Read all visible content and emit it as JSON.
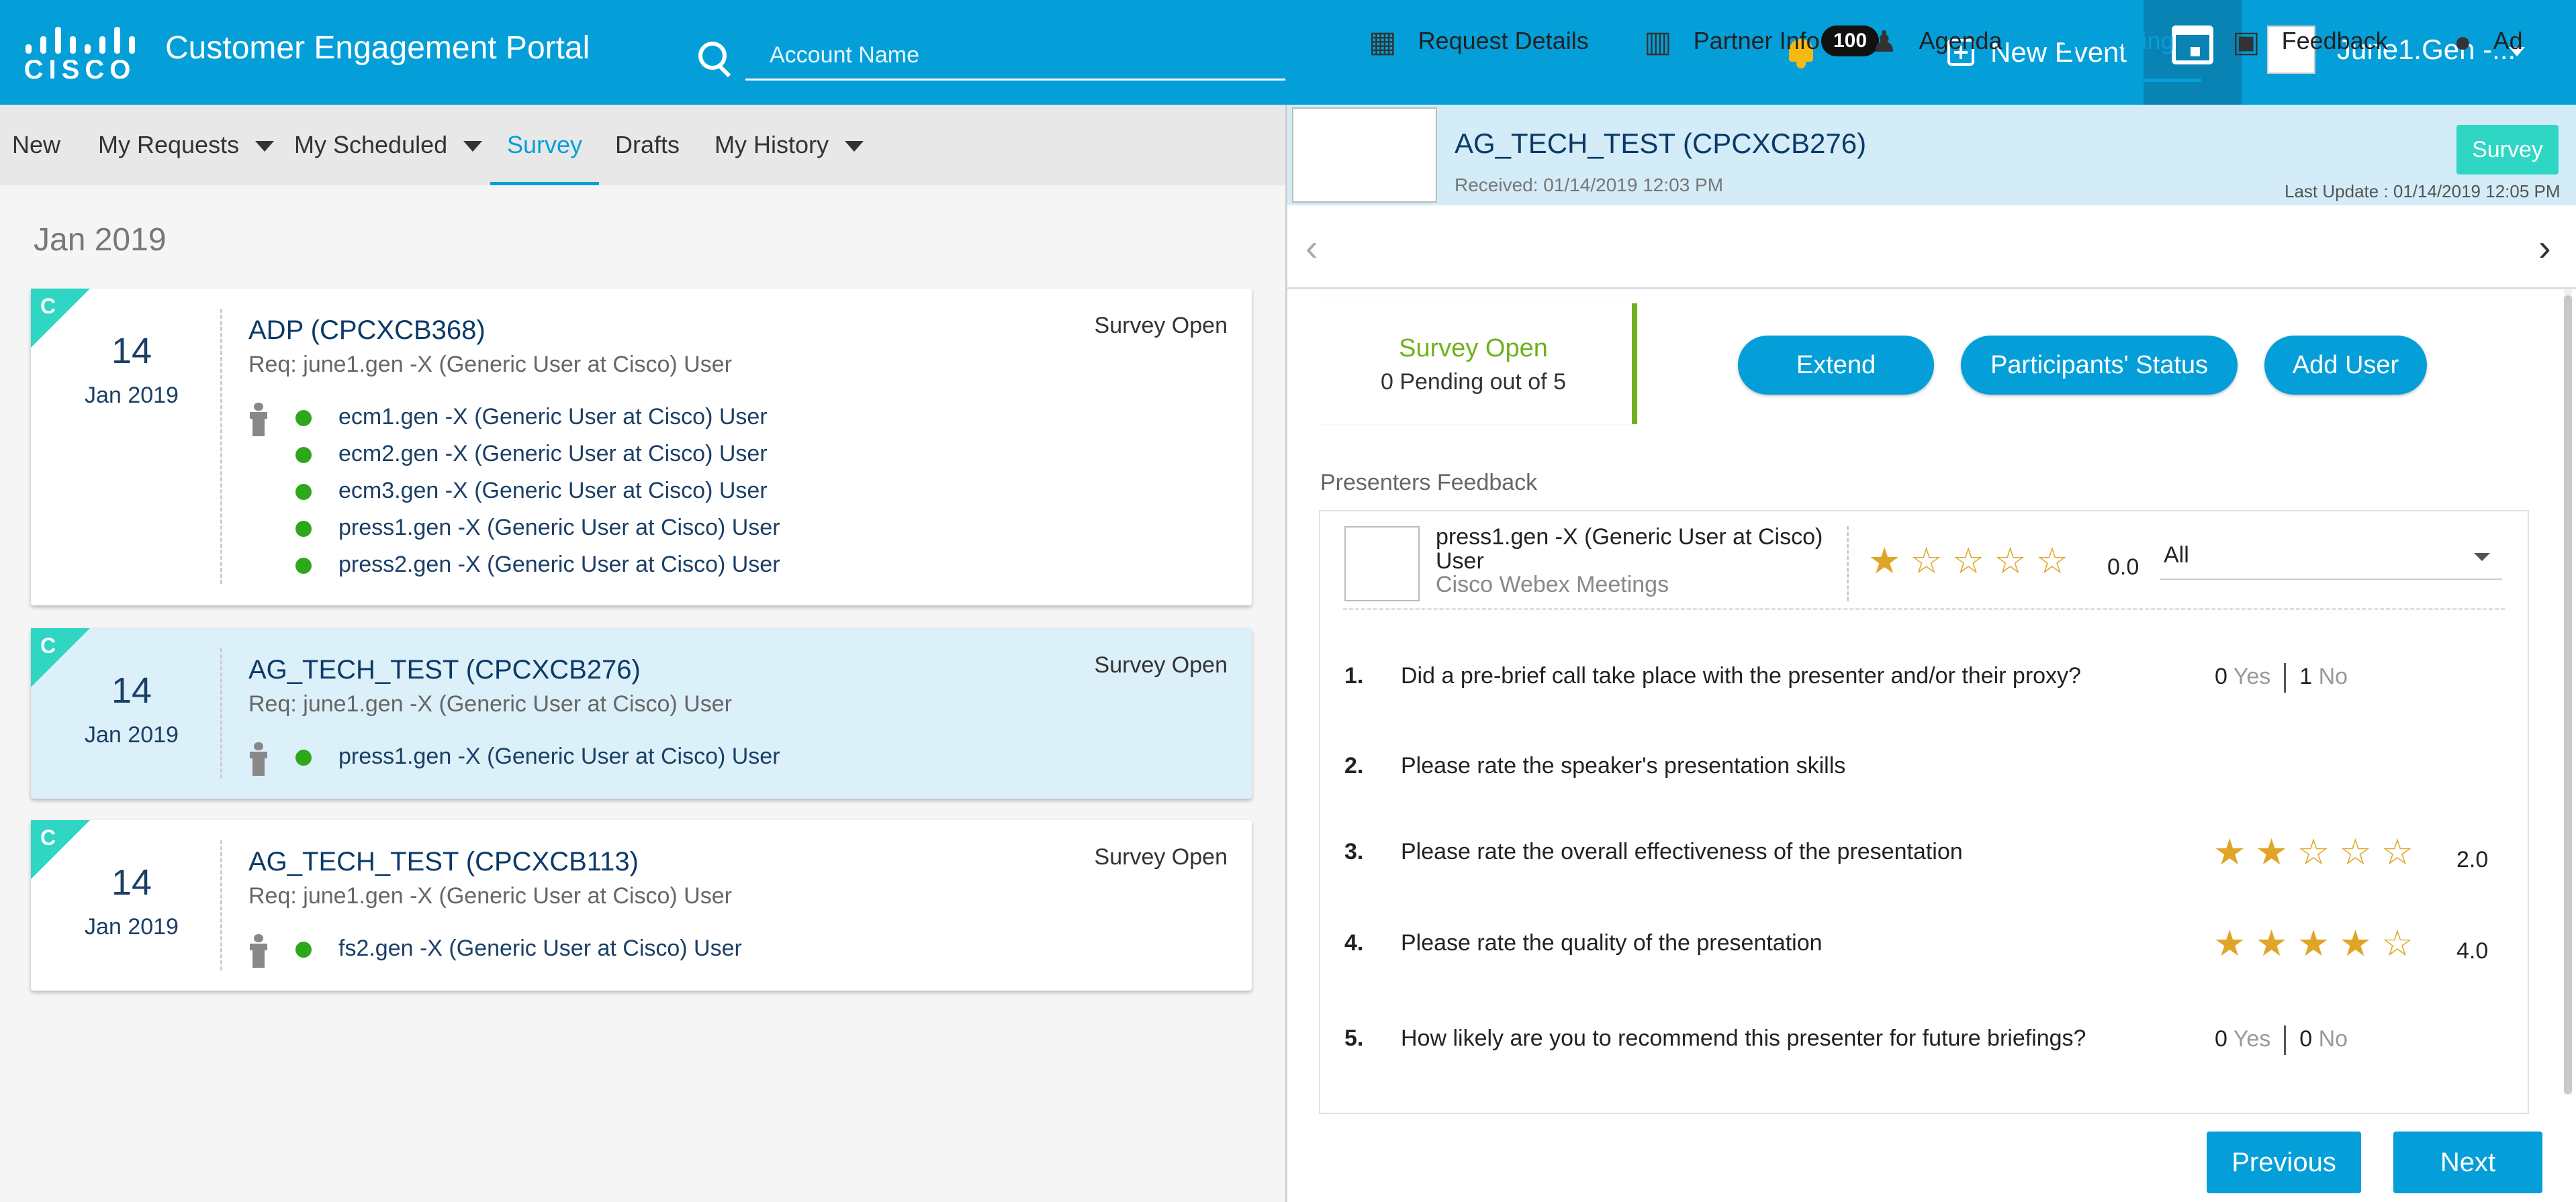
{
  "header": {
    "logo_text": "CISCO",
    "app_title": "Customer Engagement Portal",
    "search_placeholder": "Account Name",
    "notifications_count": "100",
    "new_event_label": "New Event",
    "user_name": "June1.Gen -..."
  },
  "left_nav": {
    "items": [
      "New",
      "My Requests",
      "My Scheduled",
      "Survey",
      "Drafts",
      "My History"
    ],
    "active": "Survey"
  },
  "list": {
    "month_heading": "Jan 2019",
    "cards": [
      {
        "badge": "C",
        "day": "14",
        "month": "Jan 2019",
        "title": "ADP (CPCXCB368)",
        "req": "Req: june1.gen -X (Generic User at Cisco) User",
        "status": "Survey Open",
        "attendees": [
          "ecm1.gen -X (Generic User at Cisco) User",
          "ecm2.gen -X (Generic User at Cisco) User",
          "ecm3.gen -X (Generic User at Cisco) User",
          "press1.gen -X (Generic User at Cisco) User",
          "press2.gen -X (Generic User at Cisco) User"
        ]
      },
      {
        "badge": "C",
        "day": "14",
        "month": "Jan 2019",
        "title": "AG_TECH_TEST (CPCXCB276)",
        "req": "Req: june1.gen -X (Generic User at Cisco) User",
        "status": "Survey Open",
        "attendees": [
          "press1.gen -X (Generic User at Cisco) User"
        ]
      },
      {
        "badge": "C",
        "day": "14",
        "month": "Jan 2019",
        "title": "AG_TECH_TEST (CPCXCB113)",
        "req": "Req: june1.gen -X (Generic User at Cisco) User",
        "status": "Survey Open",
        "attendees": [
          "fs2.gen -X (Generic User at Cisco) User"
        ]
      }
    ]
  },
  "detail": {
    "title": "AG_TECH_TEST (CPCXCB276)",
    "received": "Received: 01/14/2019 12:03 PM",
    "last_update": "Last Update : 01/14/2019 12:05 PM",
    "status_badge": "Survey",
    "tabs": [
      "Request Details",
      "Partner Info",
      "Agenda",
      "Rating",
      "Feedback",
      "Ad"
    ],
    "active_tab": "Rating",
    "survey_status": {
      "title": "Survey Open",
      "pending": "0 Pending out of 5"
    },
    "actions": [
      "Extend",
      "Participants' Status",
      "Add User"
    ],
    "presenters_feedback_label": "Presenters Feedback",
    "presenter": {
      "name": "press1.gen -X (Generic User at Cisco) User",
      "tool": "Cisco Webex Meetings",
      "rating": "0.0",
      "rating_stars": 0.5
    },
    "filter_value": "All",
    "questions": [
      {
        "num": "1.",
        "text": "Did a pre-brief call take place with the presenter and/or their proxy?",
        "type": "yesno",
        "yes": "0",
        "yes_label": "Yes",
        "no": "1",
        "no_label": "No"
      },
      {
        "num": "2.",
        "text": "Please rate the speaker's presentation skills",
        "type": "none"
      },
      {
        "num": "3.",
        "text": "Please rate the overall effectiveness of the presentation",
        "type": "stars",
        "stars": 2,
        "value": "2.0"
      },
      {
        "num": "4.",
        "text": "Please rate the quality of the presentation",
        "type": "stars",
        "stars": 4,
        "value": "4.0"
      },
      {
        "num": "5.",
        "text": "How likely are you to recommend this presenter for future briefings?",
        "type": "yesno",
        "yes": "0",
        "yes_label": "Yes",
        "no": "0",
        "no_label": "No"
      }
    ],
    "previous_label": "Previous",
    "next_label": "Next"
  },
  "colors": {
    "brand_blue": "#049fd9",
    "survey_green": "#6eb11c",
    "corner_teal": "#2fd6c4",
    "attendee_dot": "#2ea81b",
    "star_gold": "#e0a526"
  }
}
